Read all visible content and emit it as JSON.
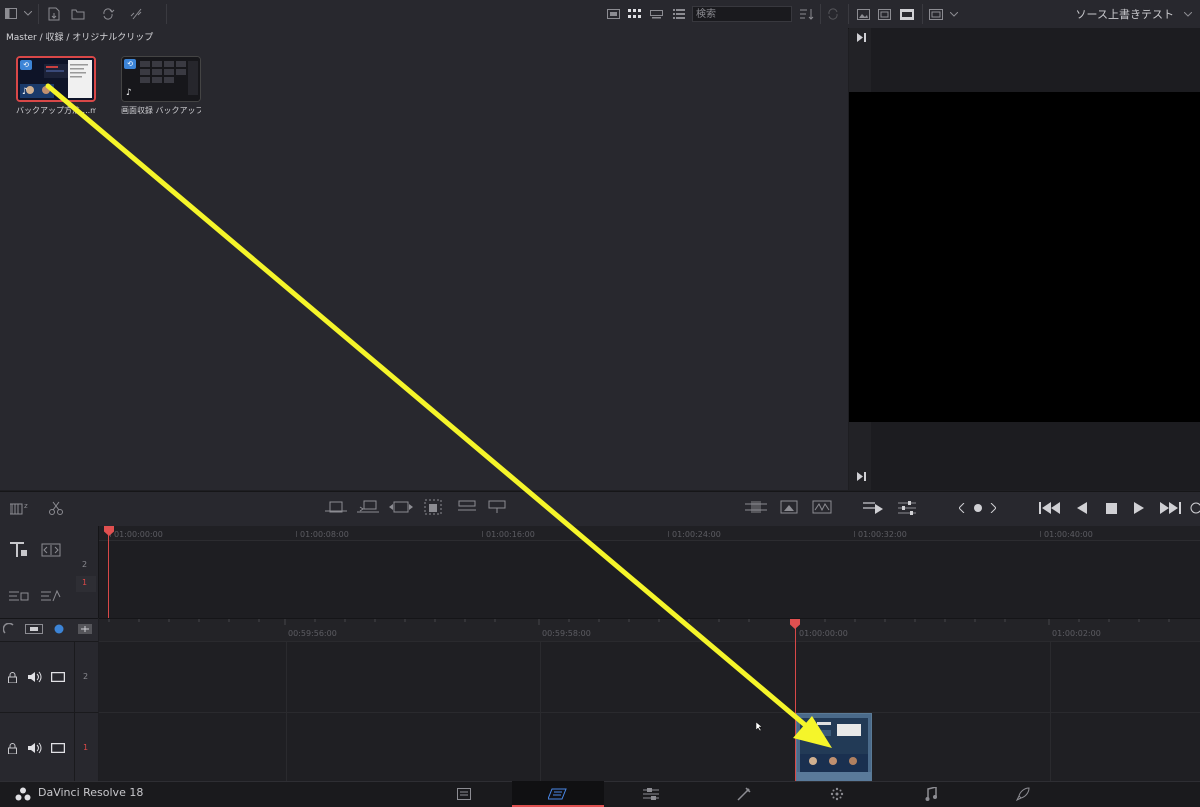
{
  "toolbar": {
    "search_placeholder": "検索",
    "viewer_title": "ソース上書きテスト"
  },
  "media_pool": {
    "breadcrumb": "Master / 収録 / オリジナルクリップ",
    "clips": [
      {
        "name": "バックアップ方法....mp4",
        "selected": true
      },
      {
        "name": "画面収録 バックアップ...",
        "selected": false
      }
    ]
  },
  "upper_timeline": {
    "timecodes": [
      "01:00:00:00",
      "01:00:08:00",
      "01:00:16:00",
      "01:00:24:00",
      "01:00:32:00",
      "01:00:40:00"
    ],
    "tracks": [
      "2",
      "1"
    ]
  },
  "lower_timeline": {
    "timecodes": [
      "00:59:56:00",
      "00:59:58:00",
      "01:00:00:00",
      "01:00:02:00"
    ],
    "tracks": [
      {
        "number": "2"
      },
      {
        "number": "1"
      }
    ]
  },
  "app": {
    "name": "DaVinci Resolve 18"
  },
  "colors": {
    "playhead": "#d84848",
    "annotation_arrow": "#f5f52a",
    "selected_clip_border": "#d94848"
  },
  "icons": {
    "page_tabs": [
      "media-page-icon",
      "cut-page-icon",
      "edit-page-icon",
      "fusion-page-icon",
      "color-page-icon",
      "fairlight-page-icon",
      "deliver-page-icon"
    ]
  }
}
